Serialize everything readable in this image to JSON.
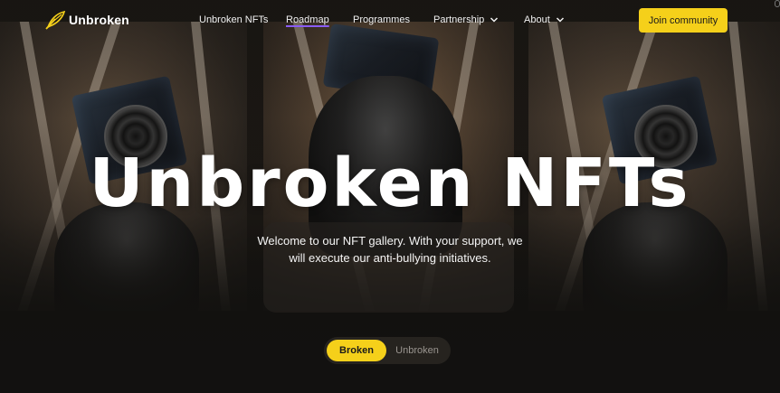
{
  "brand": {
    "name": "Unbroken",
    "logo_icon": "feather-slash-icon",
    "accent": "#f5d01a"
  },
  "nav": {
    "links": [
      {
        "label": "Unbroken NFTs"
      },
      {
        "label": "Roadmap",
        "active": true
      },
      {
        "label": "Programmes"
      },
      {
        "label": "Partnership",
        "icon": "chevron-down-icon"
      },
      {
        "label": "About",
        "icon": "chevron-down-icon"
      }
    ],
    "cta": "Join community"
  },
  "hero": {
    "title": "Unbroken NFTs",
    "subtitle_line1": "Welcome to our NFT gallery. With your support, we",
    "subtitle_line2": "will execute our anti-bullying initiatives."
  },
  "toggle": {
    "options": [
      {
        "label": "Broken",
        "selected": true
      },
      {
        "label": "Unbroken",
        "selected": false
      }
    ]
  }
}
